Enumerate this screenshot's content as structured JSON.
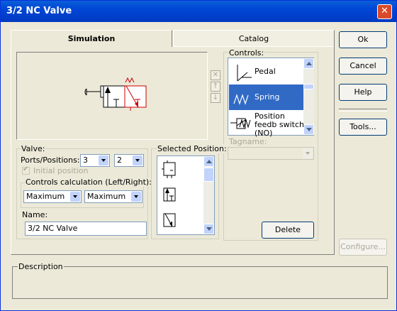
{
  "window": {
    "title": "3/2 NC Valve"
  },
  "tabs": [
    {
      "label": "Simulation"
    },
    {
      "label": "Catalog"
    }
  ],
  "side_buttons": {
    "ok": "Ok",
    "cancel": "Cancel",
    "help": "Help",
    "tools": "Tools...",
    "configure": "Configure..."
  },
  "controls": {
    "label": "Controls:",
    "items": [
      {
        "label": "Pedal"
      },
      {
        "label": "Spring"
      },
      {
        "label": "Position feedb switch (NO)"
      }
    ],
    "selected": "Spring",
    "tagname_label": "Tagname:"
  },
  "valve": {
    "group_label": "Valve:",
    "ports_label": "Ports/Positions:",
    "ports_value": "3",
    "positions_value": "2",
    "initial_position_label": "Initial position",
    "controls_calc_label": "Controls calculation (Left/Right):",
    "left_calc": "Maximum",
    "right_calc": "Maximum",
    "name_label": "Name:",
    "name_value": "3/2 NC Valve"
  },
  "selected_position": {
    "label": "Selected Position:"
  },
  "delete_label": "Delete",
  "description": {
    "label": "Description"
  },
  "colors": {
    "titlebar": "#0046D5",
    "selection": "#316AC5",
    "valve_active": "#CC0000"
  }
}
